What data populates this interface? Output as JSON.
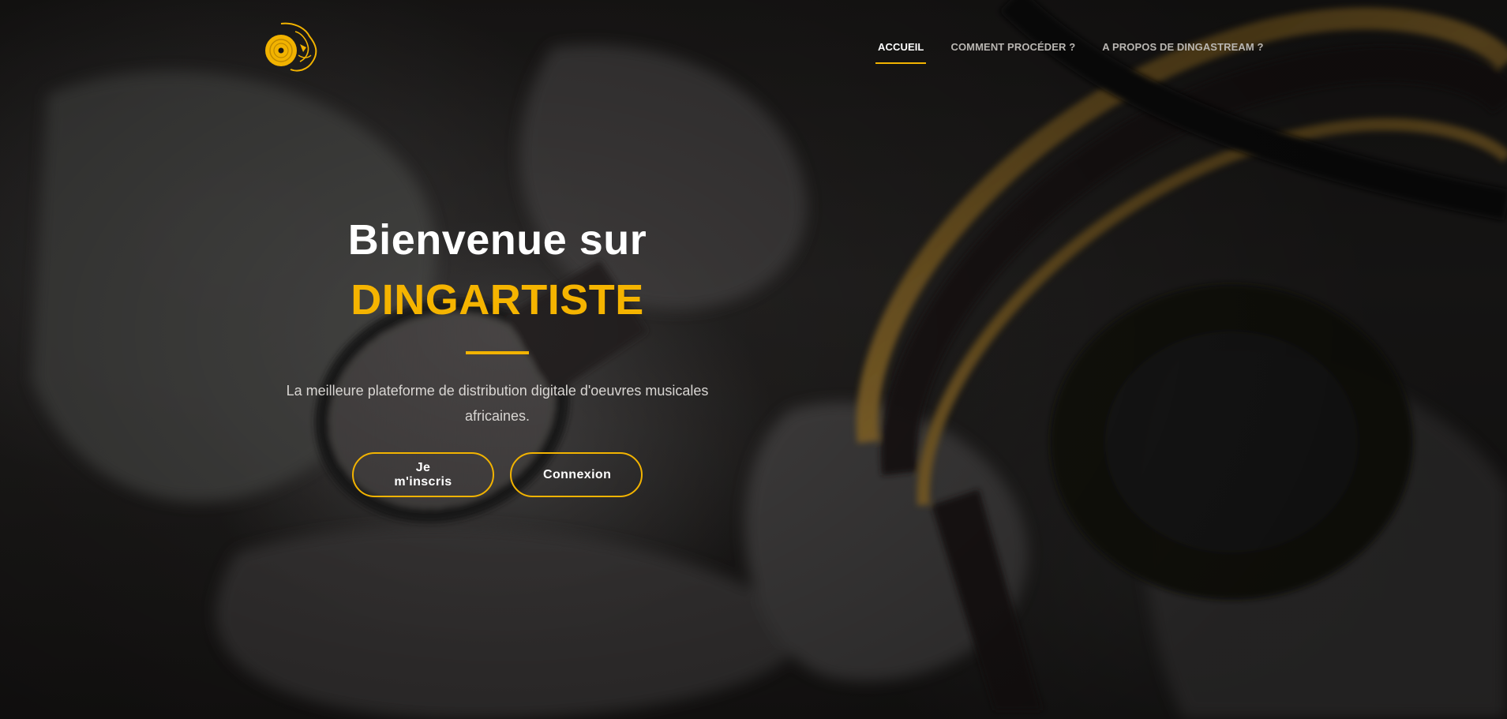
{
  "brand": {
    "logo_icon": "lion-vinyl-logo-icon",
    "accent_color": "#f2b300"
  },
  "nav": {
    "items": [
      {
        "label": "ACCUEIL",
        "active": true
      },
      {
        "label": "COMMENT PROCÉDER ?",
        "active": false
      },
      {
        "label": "A PROPOS DE DINGASTREAM ?",
        "active": false
      }
    ]
  },
  "hero": {
    "title_line1": "Bienvenue sur",
    "title_line2": "DINGARTISTE",
    "subtitle": "La meilleure plateforme de distribution digitale d'oeuvres musicales africaines.",
    "buttons": {
      "signup_label": "Je m'inscris",
      "login_label": "Connexion"
    }
  }
}
